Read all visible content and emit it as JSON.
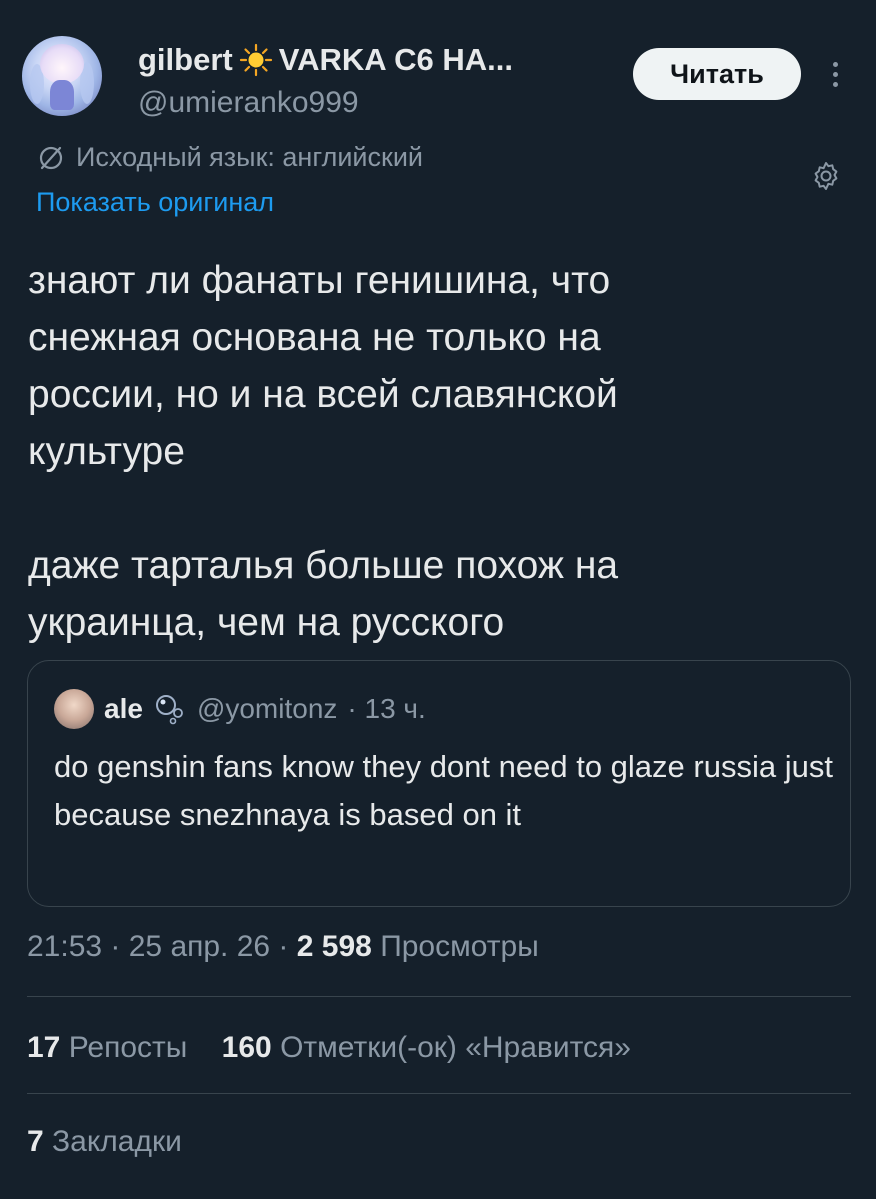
{
  "author": {
    "display_name": "gilbert",
    "name_suffix": "VARKA C6 HA...",
    "handle": "@umieranko999",
    "emoji_icon": "sun-icon"
  },
  "follow_label": "Читать",
  "translation": {
    "source_language": "Исходный язык: английский",
    "show_original": "Показать оригинал"
  },
  "post_text": "знают ли фанаты генишина, что\nснежная основана не только на\nроссии, но и на всей славянской\nкультуре\n\nдаже тарталья больше похож на\nукраинца, чем на русского",
  "quoted": {
    "name": "ale",
    "emoji_icon": "bubbles-icon",
    "handle": "@yomitonz",
    "time": "· 13 ч.",
    "text": "do genshin fans know they dont need to glaze russia just because snezhnaya is based on it"
  },
  "meta": {
    "time": "21:53 · 25 апр. 26 ·",
    "views_count": "2 598",
    "views_label": "Просмотры"
  },
  "stats": {
    "reposts_count": "17",
    "reposts_label": "Репосты",
    "likes_count": "160",
    "likes_label": "Отметки(-ок) «Нравится»",
    "bookmarks_count": "7",
    "bookmarks_label": "Закладки"
  },
  "colors": {
    "background": "#15202b",
    "text": "#e7e9ea",
    "muted": "#8b98a5",
    "accent": "#1d9bf0",
    "border": "#38444d"
  }
}
